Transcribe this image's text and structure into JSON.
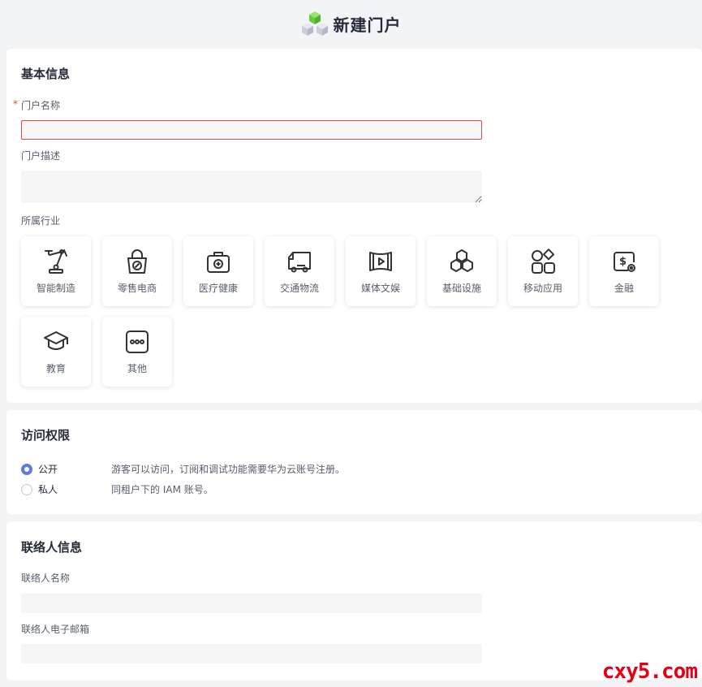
{
  "header": {
    "title": "新建门户"
  },
  "basic": {
    "section_title": "基本信息",
    "name_label": "门户名称",
    "required_mark": "*",
    "name_value": "",
    "desc_label": "门户描述",
    "desc_value": "",
    "industry_label": "所属行业",
    "industries": [
      {
        "label": "智能制造",
        "icon": "robot-arm-icon"
      },
      {
        "label": "零售电商",
        "icon": "shopping-bag-icon"
      },
      {
        "label": "医疗健康",
        "icon": "medical-kit-icon"
      },
      {
        "label": "交通物流",
        "icon": "truck-icon"
      },
      {
        "label": "媒体文娱",
        "icon": "film-icon"
      },
      {
        "label": "基础设施",
        "icon": "cubes-icon"
      },
      {
        "label": "移动应用",
        "icon": "apps-icon"
      },
      {
        "label": "金融",
        "icon": "finance-icon"
      },
      {
        "label": "教育",
        "icon": "graduation-cap-icon"
      },
      {
        "label": "其他",
        "icon": "more-icon"
      }
    ]
  },
  "access": {
    "section_title": "访问权限",
    "options": [
      {
        "label": "公开",
        "desc": "游客可以访问，订阅和调试功能需要华为云账号注册。",
        "checked": true
      },
      {
        "label": "私人",
        "desc": "同租户下的 IAM 账号。",
        "checked": false
      }
    ]
  },
  "contact": {
    "section_title": "联络人信息",
    "name_label": "联络人名称",
    "name_value": "",
    "email_label": "联络人电子邮箱",
    "email_value": ""
  },
  "watermark": "cxy5.com",
  "colors": {
    "accent": "#5e7ce0",
    "error": "#e6463a",
    "watermark": "#e60012"
  }
}
